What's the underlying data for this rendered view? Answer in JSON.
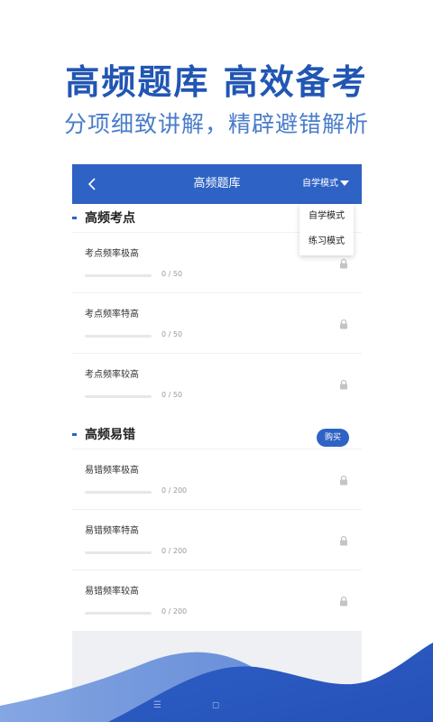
{
  "promo": {
    "title": "高频题库  高效备考",
    "subtitle": "分项细致讲解，精辟避错解析"
  },
  "navbar": {
    "back_icon": "chevron-left-icon",
    "title": "高频题库",
    "mode_label": "自学模式"
  },
  "dropdown": {
    "items": [
      {
        "label": "自学模式"
      },
      {
        "label": "练习模式"
      }
    ]
  },
  "sections": [
    {
      "title": "高频考点",
      "rows": [
        {
          "title": "考点频率极高",
          "count": "0 / 50",
          "progress": 0
        },
        {
          "title": "考点频率特高",
          "count": "0 / 50",
          "progress": 0
        },
        {
          "title": "考点频率较高",
          "count": "0 / 50",
          "progress": 0
        }
      ]
    },
    {
      "title": "高频易错",
      "buy_label": "购买",
      "rows": [
        {
          "title": "易错频率极高",
          "count": "0 / 200",
          "progress": 0
        },
        {
          "title": "易错频率特高",
          "count": "0 / 200",
          "progress": 0
        },
        {
          "title": "易错频率较高",
          "count": "0 / 200",
          "progress": 0
        }
      ]
    }
  ],
  "colors": {
    "primary": "#2e62c4",
    "title_blue": "#2156b3",
    "subtitle_blue": "#4a7dc9",
    "lock_gray": "#c4c4c4"
  }
}
